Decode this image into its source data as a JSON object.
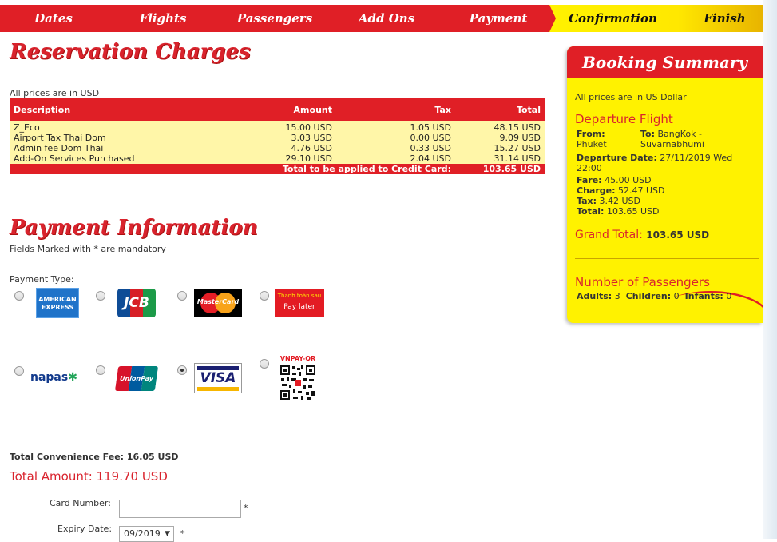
{
  "steps": [
    {
      "label": "Dates"
    },
    {
      "label": "Flights"
    },
    {
      "label": "Passengers"
    },
    {
      "label": "Add Ons"
    },
    {
      "label": "Payment"
    },
    {
      "label": "Confirmation"
    },
    {
      "label": "Finish"
    }
  ],
  "charges": {
    "title": "Reservation Charges",
    "currency_note": "All prices are in USD",
    "headers": {
      "description": "Description",
      "amount": "Amount",
      "tax": "Tax",
      "total": "Total"
    },
    "rows": [
      {
        "description": "Z_Eco",
        "amount": "15.00 USD",
        "tax": "1.05 USD",
        "total": "48.15 USD"
      },
      {
        "description": "Airport Tax Thai Dom",
        "amount": "3.03 USD",
        "tax": "0.00 USD",
        "total": "9.09 USD"
      },
      {
        "description": "Admin fee Dom Thai",
        "amount": "4.76 USD",
        "tax": "0.33 USD",
        "total": "15.27 USD"
      },
      {
        "description": "Add-On Services Purchased",
        "amount": "29.10 USD",
        "tax": "2.04 USD",
        "total": "31.14 USD"
      }
    ],
    "total_label": "Total to be applied to Credit Card:",
    "total_value": "103.65 USD"
  },
  "payment": {
    "title": "Payment Information",
    "mandatory_note": "Fields Marked with * are mandatory",
    "type_label": "Payment Type:",
    "logos": {
      "amex_line1": "AMERICAN",
      "amex_line2": "EXPRESS",
      "jcb": "JCB",
      "mastercard": "MasterCard",
      "paylater_line1": "Thanh toán sau",
      "paylater_line2": "Pay later",
      "napas": "napas",
      "unionpay": "UnionPay",
      "visa": "VISA",
      "vnpay": "VNPAY-QR"
    },
    "convenience_fee": "Total Convenience Fee: 16.05 USD",
    "total_amount": "Total Amount: 119.70 USD",
    "card_number_label": "Card Number:",
    "card_number_value": "",
    "expiry_label": "Expiry Date:",
    "expiry_value": "09/2019",
    "required_mark": "*"
  },
  "summary": {
    "title": "Booking Summary",
    "currency_note": "All prices are in US Dollar",
    "departure_title": "Departure Flight",
    "from_label": "From:",
    "from_value": "Phuket",
    "to_label": "To:",
    "to_value_line1": "BangKok -",
    "to_value_line2": "Suvarnabhumi",
    "departure_date_label": "Departure Date:",
    "departure_date_value": "27/11/2019 Wed",
    "departure_time": "22:00",
    "fare_label": "Fare:",
    "fare_value": "45.00 USD",
    "charge_label": "Charge:",
    "charge_value": "52.47 USD",
    "tax_label": "Tax:",
    "tax_value": "3.42 USD",
    "total_label": "Total:",
    "total_value": "103.65 USD",
    "grand_total_label": "Grand Total:",
    "grand_total_value": "103.65 USD",
    "passengers_title": "Number of Passengers",
    "adults_label": "Adults:",
    "adults_value": "3",
    "children_label": "Children:",
    "children_value": "0",
    "infants_label": "Infants:",
    "infants_value": "0"
  },
  "colors": {
    "brand_red": "#e01f26",
    "brand_yellow": "#fff200"
  }
}
